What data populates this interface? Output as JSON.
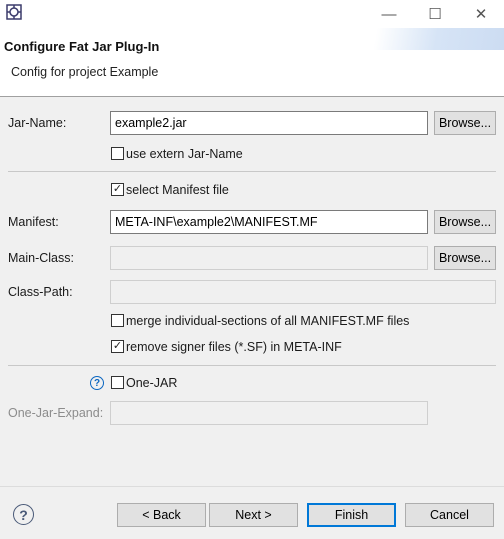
{
  "window": {
    "minimize_icon": "minimize-icon",
    "maximize_icon": "maximize-icon",
    "close_icon": "close-icon",
    "minimize_glyph": "—",
    "maximize_glyph": "☐",
    "close_glyph": "✕"
  },
  "header": {
    "title": "Configure Fat Jar Plug-In",
    "description": "Config for project Example"
  },
  "jar": {
    "label": "Jar-Name:",
    "value": "example2.jar",
    "browse_label": "Browse...",
    "use_extern_label": "use extern Jar-Name",
    "use_extern_checked": false
  },
  "manifest_section": {
    "select_manifest_label": "select Manifest file",
    "select_manifest_checked": true,
    "manifest_label": "Manifest:",
    "manifest_value": "META-INF\\example2\\MANIFEST.MF",
    "manifest_browse_label": "Browse...",
    "main_class_label": "Main-Class:",
    "main_class_value": "",
    "main_class_browse_label": "Browse...",
    "class_path_label": "Class-Path:",
    "class_path_value": "",
    "merge_label": "merge individual-sections of all MANIFEST.MF files",
    "merge_checked": false,
    "remove_signer_label": "remove signer files (*.SF) in META-INF",
    "remove_signer_checked": true
  },
  "onejar": {
    "help_glyph": "?",
    "label": "One-JAR",
    "checked": false,
    "expand_label": "One-Jar-Expand:",
    "expand_value": ""
  },
  "footer": {
    "help_glyph": "?",
    "back_label": "< Back",
    "next_label": "Next >",
    "finish_label": "Finish",
    "cancel_label": "Cancel"
  },
  "check_glyph": "✓"
}
